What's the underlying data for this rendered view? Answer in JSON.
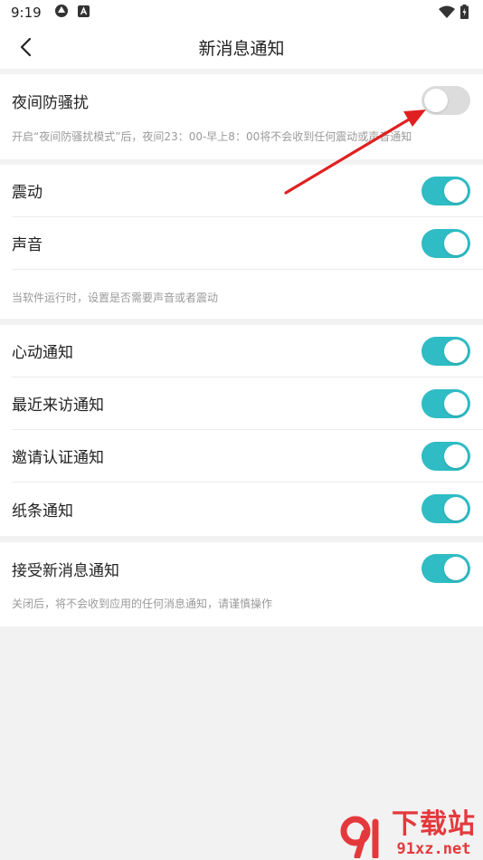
{
  "status_bar": {
    "time": "9:19"
  },
  "header": {
    "title": "新消息通知"
  },
  "sections": {
    "dnd": {
      "label": "夜间防骚扰",
      "enabled": false,
      "hint": "开启“夜间防骚扰模式”后，夜间23：00-早上8：00将不会收到任何震动或声音通知"
    },
    "alerts": {
      "items": [
        {
          "label": "震动",
          "enabled": true
        },
        {
          "label": "声音",
          "enabled": true
        }
      ],
      "hint": "当软件运行时，设置是否需要声音或者震动"
    },
    "notifications": {
      "items": [
        {
          "label": "心动通知",
          "enabled": true
        },
        {
          "label": "最近来访通知",
          "enabled": true
        },
        {
          "label": "邀请认证通知",
          "enabled": true
        },
        {
          "label": "纸条通知",
          "enabled": true
        }
      ]
    },
    "master": {
      "label": "接受新消息通知",
      "enabled": true,
      "hint": "关闭后，将不会收到应用的任何消息通知，请谨慎操作"
    }
  },
  "watermark": {
    "top": "下载站",
    "bottom": "91xz.net"
  },
  "colors": {
    "accent": "#2fbcc4",
    "toggle_off": "#dcdcdc",
    "arrow": "#e02020",
    "watermark": "#e4393c"
  }
}
